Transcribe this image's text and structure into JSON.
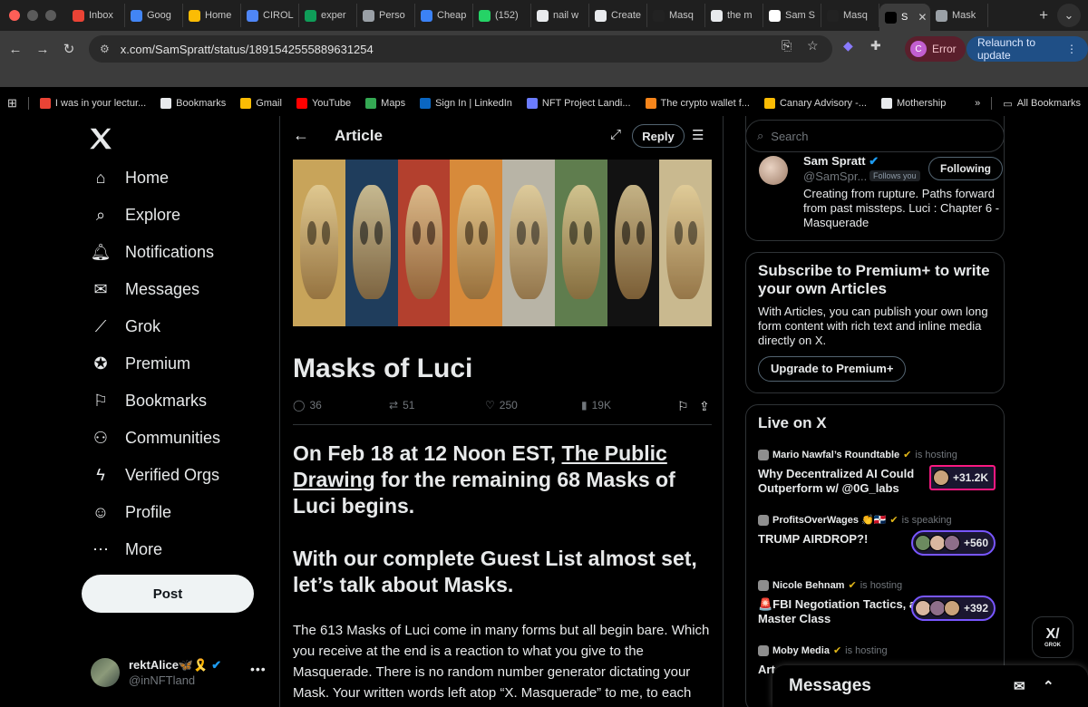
{
  "browser": {
    "tabs": [
      {
        "label": "Inbox",
        "color": "#ea4335"
      },
      {
        "label": "Goog",
        "color": "#4285f4"
      },
      {
        "label": "Home",
        "color": "#fbbc04"
      },
      {
        "label": "CIROL",
        "color": "#4f86f7"
      },
      {
        "label": "exper",
        "color": "#0f9d58"
      },
      {
        "label": "Perso",
        "color": "#9aa0a6"
      },
      {
        "label": "Cheap",
        "color": "#3b82f6"
      },
      {
        "label": "(152)",
        "color": "#25d366"
      },
      {
        "label": "nail w",
        "color": "#e8eaed"
      },
      {
        "label": "Create",
        "color": "#e8eaed"
      },
      {
        "label": "Masq",
        "color": "#222222"
      },
      {
        "label": "the m",
        "color": "#e8eaed"
      },
      {
        "label": "Sam S",
        "color": "#ffffff"
      },
      {
        "label": "Masq",
        "color": "#222222"
      },
      {
        "label": "S",
        "color": "#000000",
        "active": true
      },
      {
        "label": "Mask",
        "color": "#9aa0a6"
      }
    ],
    "url": "x.com/SamSpratt/status/1891542555889631254",
    "error_label": "Error",
    "error_avatar": "C",
    "relaunch_label": "Relaunch to update",
    "bookmarks": [
      {
        "label": "I was in your lectur...",
        "color": "#ea4335"
      },
      {
        "label": "Bookmarks",
        "color": "#e8eaed"
      },
      {
        "label": "Gmail",
        "color": "#fbbc04"
      },
      {
        "label": "YouTube",
        "color": "#ff0000"
      },
      {
        "label": "Maps",
        "color": "#34a853"
      },
      {
        "label": "Sign In | LinkedIn",
        "color": "#0a66c2"
      },
      {
        "label": "NFT Project Landi...",
        "color": "#6b7cff"
      },
      {
        "label": "The crypto wallet f...",
        "color": "#f6851b"
      },
      {
        "label": "Canary Advisory -...",
        "color": "#fbbc04"
      },
      {
        "label": "Mothership",
        "color": "#e8eaed"
      }
    ],
    "all_bookmarks_label": "All Bookmarks",
    "overflow_label": "»"
  },
  "nav": {
    "items": [
      {
        "label": "Home",
        "icon": "home-icon"
      },
      {
        "label": "Explore",
        "icon": "search-icon"
      },
      {
        "label": "Notifications",
        "icon": "bell-icon"
      },
      {
        "label": "Messages",
        "icon": "mail-icon"
      },
      {
        "label": "Grok",
        "icon": "grok-icon"
      },
      {
        "label": "Premium",
        "icon": "premium-icon"
      },
      {
        "label": "Bookmarks",
        "icon": "bookmark-icon"
      },
      {
        "label": "Communities",
        "icon": "communities-icon"
      },
      {
        "label": "Verified Orgs",
        "icon": "lightning-icon"
      },
      {
        "label": "Profile",
        "icon": "person-icon"
      },
      {
        "label": "More",
        "icon": "more-icon"
      }
    ],
    "post_label": "Post",
    "user": {
      "name": "rektAlice🦋🎗️",
      "handle": "@inNFTland"
    }
  },
  "article": {
    "header_title": "Article",
    "reply_label": "Reply",
    "title": "Masks of Luci",
    "stats": {
      "replies": "36",
      "reposts": "51",
      "likes": "250",
      "views": "19K"
    },
    "h2_a_pre": "On Feb 18 at 12 Noon EST, ",
    "h2_a_link": "The Public Drawing",
    "h2_a_post": " for the remaining 68 Masks of Luci begins.",
    "h2_b": "With our complete Guest List almost set, let’s talk about Masks.",
    "body": "The 613 Masks of Luci come in many forms but all begin bare. Which you receive at the end is a reaction to what you give to the Masquerade. There is no random number generator dictating your Mask. Your written words left atop “X. Masquerade” to me, to each other, and to yourself",
    "hero_stripes": [
      "#c8a45a",
      "#1f3d5c",
      "#b3402e",
      "#d78a3a",
      "#b8b4a6",
      "#5f7d4e",
      "#121212",
      "#c9b98f"
    ]
  },
  "sidebar": {
    "search_placeholder": "Search",
    "author": {
      "name": "Sam Spratt",
      "handle": "@SamSpr...",
      "follows_you": "Follows you",
      "following_label": "Following",
      "bio": "Creating from rupture. Paths forward from past missteps. Luci : Chapter 6 - Masquerade"
    },
    "premium": {
      "title": "Subscribe to Premium+ to write your own Articles",
      "desc": "With Articles, you can publish your own long form content with rich text and inline media directly on X.",
      "button": "Upgrade to Premium+"
    },
    "live": {
      "title": "Live on X",
      "items": [
        {
          "host": "Mario Nawfal’s Roundtable",
          "status": "is hosting",
          "topic": "Why Decentralized AI Could Outperform w/ @0G_labs",
          "count": "+31.2K",
          "border": "#f91880"
        },
        {
          "host": "ProfitsOverWages 👏🇩🇴",
          "status": "is speaking",
          "topic": "TRUMP AIRDROP?!",
          "count": "+560",
          "border": "#7856ff"
        },
        {
          "host": "Nicole Behnam",
          "status": "is hosting",
          "topic": "🚨FBI Negotiation Tactics, a Master Class",
          "count": "+392",
          "border": "#7856ff"
        },
        {
          "host": "Moby Media",
          "status": "is hosting",
          "topic": "Art o... @st...",
          "count": "",
          "border": "#7856ff"
        }
      ]
    }
  },
  "grok_label": "GROK",
  "messages_label": "Messages"
}
